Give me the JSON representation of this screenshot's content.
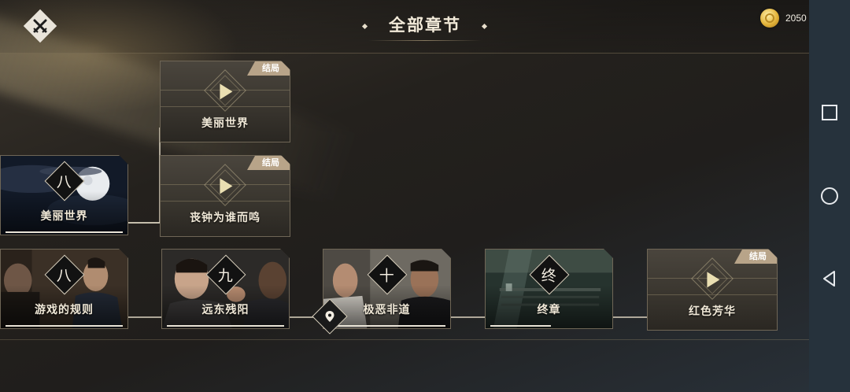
{
  "header": {
    "title": "全部章节",
    "coins": "2050"
  },
  "badges": {
    "ending": "结局"
  },
  "chapters": {
    "top_branch": {
      "label": "美丽世界",
      "badge": "结局"
    },
    "mid_branch": {
      "label": "丧钟为谁而鸣",
      "badge": "结局"
    },
    "ch8_moon": {
      "number": "八",
      "label": "美丽世界"
    },
    "ch8_rules": {
      "number": "八",
      "label": "游戏的规则"
    },
    "ch9": {
      "number": "九",
      "label": "远东残阳"
    },
    "ch10": {
      "number": "十",
      "label": "极恶非道"
    },
    "final": {
      "number": "终",
      "label": "终章"
    },
    "red_end": {
      "label": "红色芳华",
      "badge": "结局"
    }
  },
  "icons": {
    "close": "close-swords-icon",
    "coin": "coin-icon",
    "location": "location-pin-icon",
    "play": "play-icon",
    "nav_recent": "square-icon",
    "nav_home": "circle-icon",
    "nav_back": "triangle-back-icon"
  },
  "colors": {
    "accent_gold": "#e2b33a",
    "badge_bg": "#b8a489",
    "navbar_bg": "#26323c"
  }
}
